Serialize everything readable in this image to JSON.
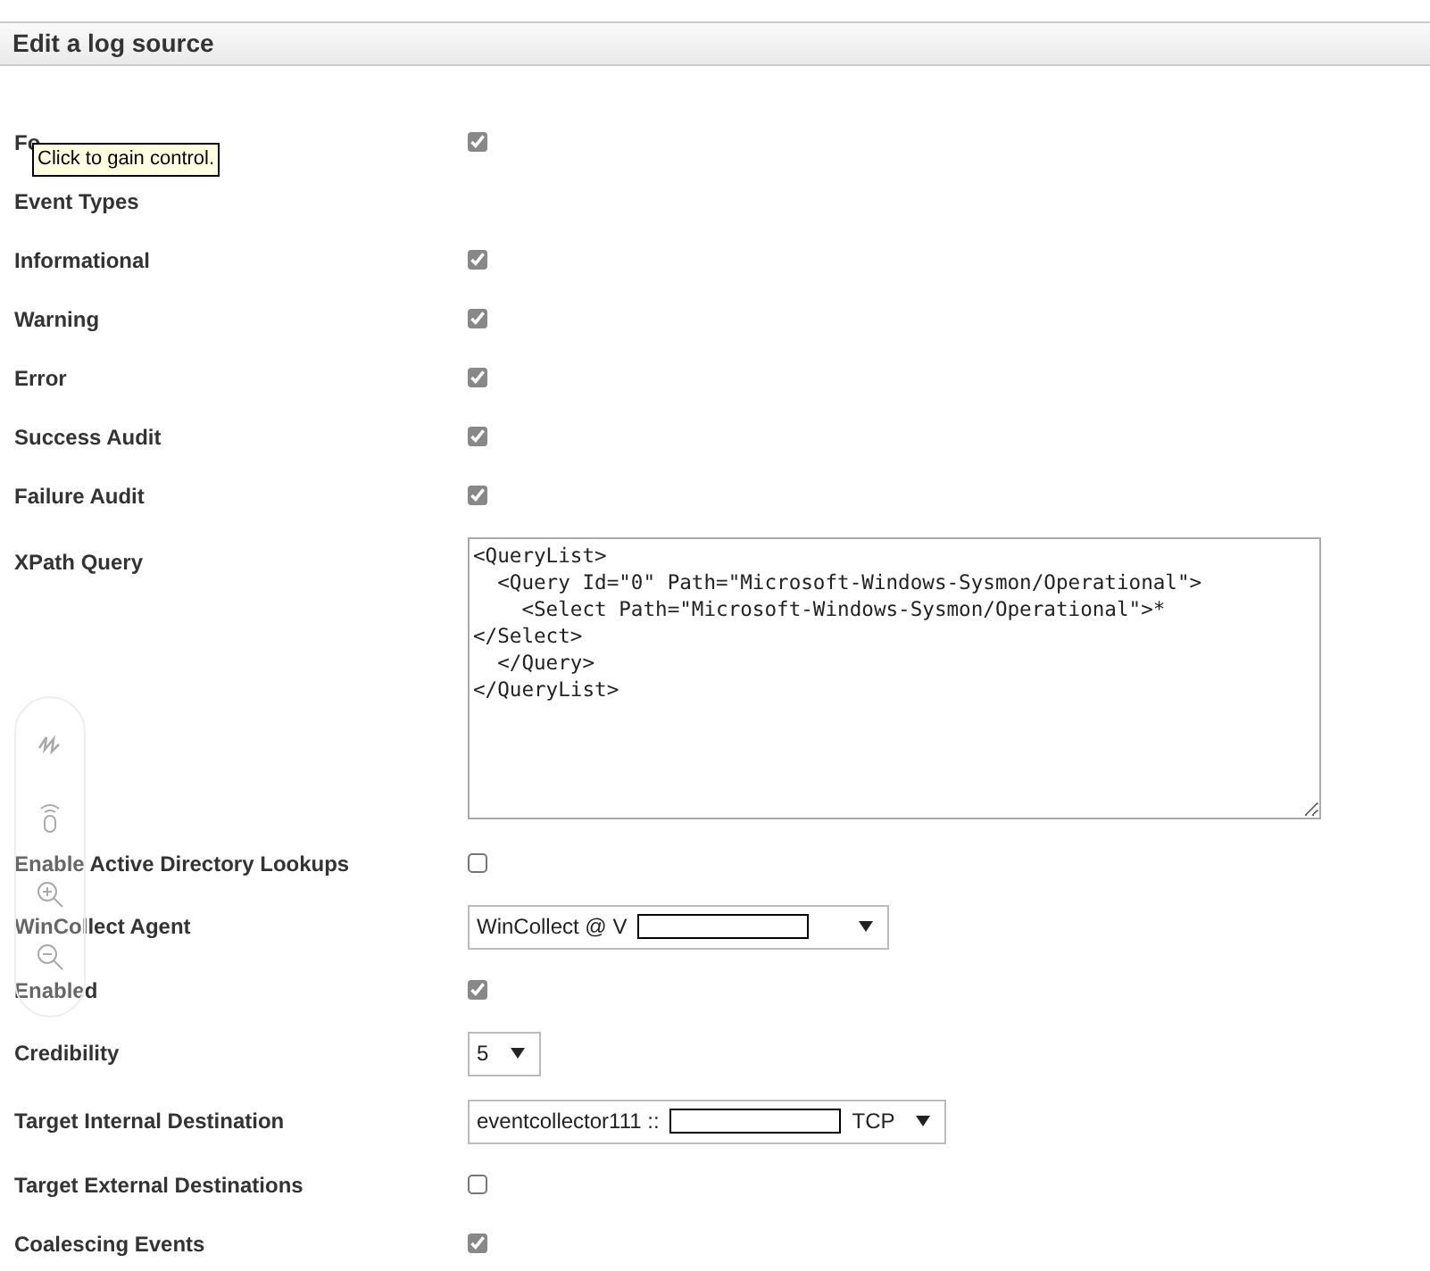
{
  "header": {
    "title": "Edit a log source"
  },
  "fields": [
    {
      "kind": "checkbox",
      "label": "Fo",
      "checked": true
    },
    {
      "kind": "heading",
      "label": "Event Types"
    },
    {
      "kind": "checkbox",
      "label": "Informational",
      "checked": true
    },
    {
      "kind": "checkbox",
      "label": "Warning",
      "checked": true
    },
    {
      "kind": "checkbox",
      "label": "Error",
      "checked": true
    },
    {
      "kind": "checkbox",
      "label": "Success Audit",
      "checked": true
    },
    {
      "kind": "checkbox",
      "label": "Failure Audit",
      "checked": true
    },
    {
      "kind": "textarea",
      "label": "XPath Query",
      "value": "<QueryList>\n  <Query Id=\"0\" Path=\"Microsoft-Windows-Sysmon/Operational\">\n    <Select Path=\"Microsoft-Windows-Sysmon/Operational\">*\n</Select>\n  </Query>\n</QueryList>"
    },
    {
      "kind": "checkbox",
      "label": "Enable Active Directory Lookups",
      "checked": false
    },
    {
      "kind": "select",
      "label": "WinCollect Agent",
      "value": "WinCollect @ V",
      "redacted": true
    },
    {
      "kind": "checkbox",
      "label": "Enabled",
      "checked": true
    },
    {
      "kind": "select",
      "label": "Credibility",
      "value": "5"
    },
    {
      "kind": "select",
      "label": "Target Internal Destination",
      "value": "eventcollector111 ::",
      "redacted": true,
      "suffix": "TCP"
    },
    {
      "kind": "checkbox",
      "label": "Target External Destinations",
      "checked": false
    },
    {
      "kind": "checkbox",
      "label": "Coalescing Events",
      "checked": true
    }
  ],
  "tooltip": {
    "text": "Click to gain control."
  }
}
